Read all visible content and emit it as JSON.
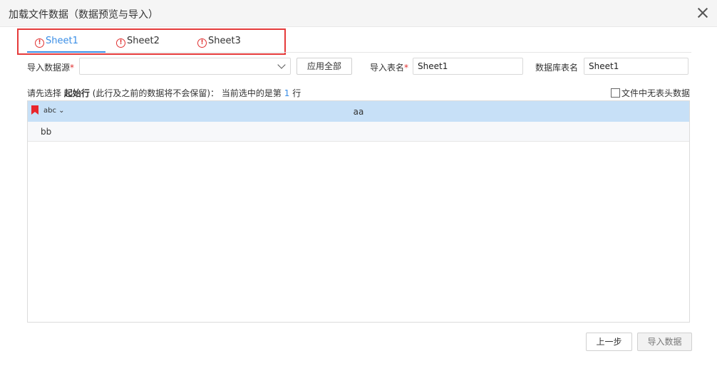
{
  "dialog": {
    "title": "加载文件数据（数据预览与导入）"
  },
  "tabs": [
    {
      "label": "Sheet1",
      "active": true,
      "warning": true
    },
    {
      "label": "Sheet2",
      "active": false,
      "warning": true
    },
    {
      "label": "Sheet3",
      "active": false,
      "warning": true
    }
  ],
  "form": {
    "source_label": "导入数据源",
    "source_value": "",
    "apply_all_label": "应用全部",
    "import_table_label": "导入表名",
    "import_table_value": "Sheet1",
    "db_table_label": "数据库表名",
    "db_table_value": "Sheet1",
    "required_mark": "*"
  },
  "hint": {
    "prefix": "请先选择",
    "bold": "起始行",
    "middle": "(此行及之前的数据将不会保留)：",
    "current": "当前选中的是第",
    "row_number": "1",
    "suffix": "行"
  },
  "no_header": {
    "label": "文件中无表头数据",
    "checked": false
  },
  "grid": {
    "type_tag": "abc",
    "column_header": "aa",
    "rows": [
      "bb"
    ]
  },
  "footer": {
    "prev_label": "上一步",
    "import_label": "导入数据"
  },
  "colors": {
    "accent": "#3a8ee6",
    "warning": "#e03131",
    "header_bg": "#c7e0f7",
    "highlight_border": "#e53a3a"
  }
}
